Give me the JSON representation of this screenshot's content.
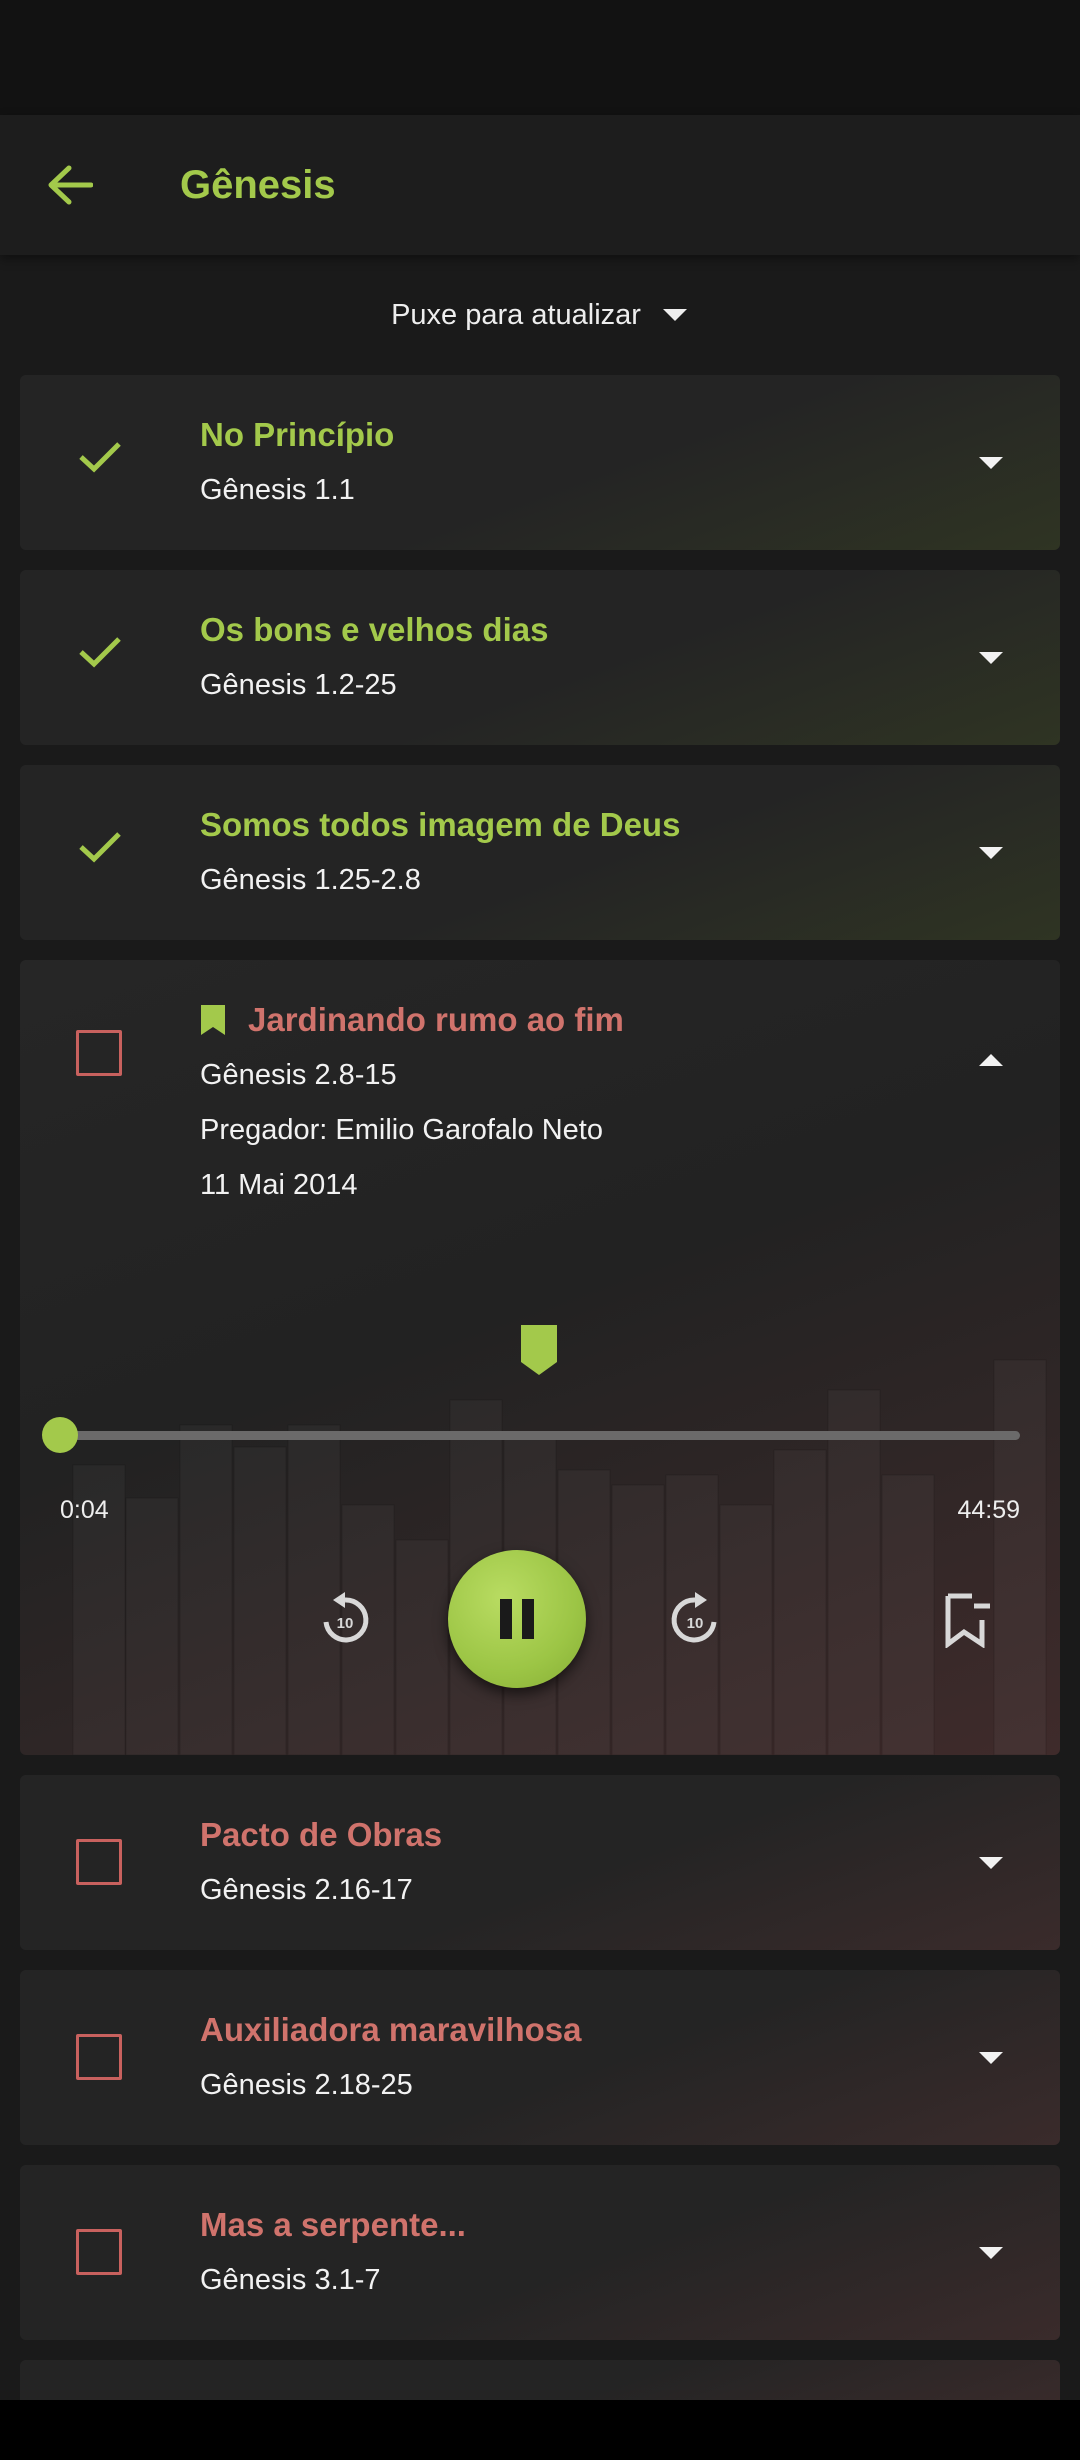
{
  "header": {
    "title": "Gênesis"
  },
  "refresh": {
    "label": "Puxe para atualizar"
  },
  "colors": {
    "accent": "#a3c94b",
    "pending": "#d0736c",
    "background": "#1a1a1a"
  },
  "sermons": [
    {
      "title": "No Princípio",
      "reference": "Gênesis 1.1",
      "completed": true
    },
    {
      "title": "Os bons e velhos dias",
      "reference": "Gênesis 1.2-25",
      "completed": true
    },
    {
      "title": "Somos todos imagem de Deus",
      "reference": "Gênesis 1.25-2.8",
      "completed": true
    },
    {
      "title": "Jardinando rumo ao fim",
      "reference": "Gênesis 2.8-15",
      "completed": false,
      "bookmarked": true,
      "preacher": "Pregador: Emilio Garofalo Neto",
      "date": "11 Mai 2014"
    },
    {
      "title": "Pacto de Obras",
      "reference": "Gênesis 2.16-17",
      "completed": false
    },
    {
      "title": "Auxiliadora maravilhosa",
      "reference": "Gênesis 2.18-25",
      "completed": false
    },
    {
      "title": "Mas a serpente...",
      "reference": "Gênesis 3.1-7",
      "completed": false
    }
  ],
  "player": {
    "elapsed": "0:04",
    "duration": "44:59",
    "progress_fraction": 0.0015,
    "state": "playing",
    "rewind_seconds": "10",
    "forward_seconds": "10"
  }
}
